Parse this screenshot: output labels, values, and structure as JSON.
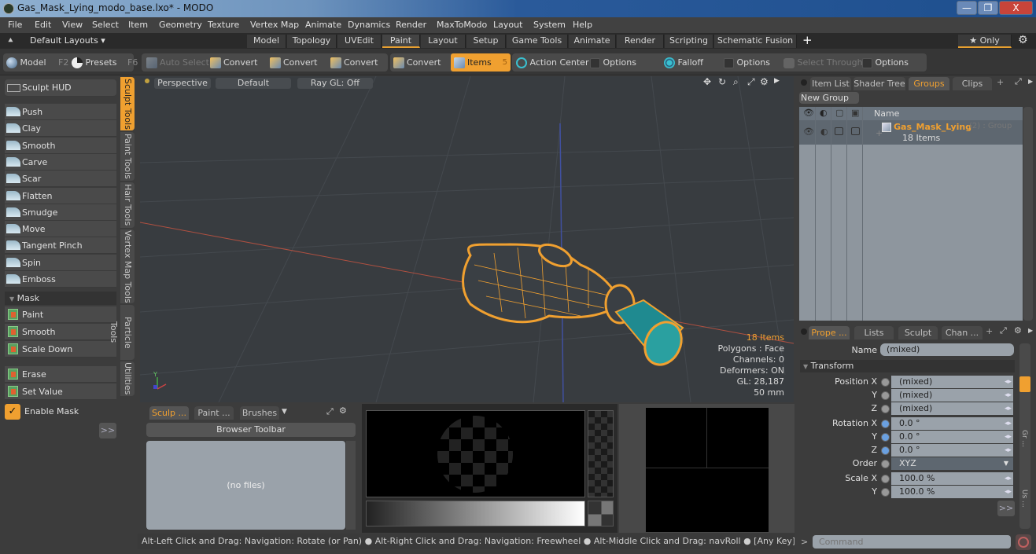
{
  "window": {
    "title": "Gas_Mask_Lying_modo_base.lxo* - MODO",
    "controls": {
      "minimize": "—",
      "maximize": "❐",
      "close": "X"
    }
  },
  "menu": [
    "File",
    "Edit",
    "View",
    "Select",
    "Item",
    "Geometry",
    "Texture",
    "Vertex Map",
    "Animate",
    "Dynamics",
    "Render",
    "MaxToModo",
    "Layout",
    "System",
    "Help"
  ],
  "layout_bar": {
    "layouts_label": "Default Layouts ▾",
    "tabs": [
      "Model",
      "Topology",
      "UVEdit",
      "Paint",
      "Layout",
      "Setup",
      "Game Tools",
      "Animate",
      "Render",
      "Scripting",
      "Schematic Fusion"
    ],
    "active_tab": "Paint",
    "add": "+",
    "only_label": "★ Only"
  },
  "toolbar": {
    "model": "Model",
    "model_key": "F2",
    "presets": "Presets",
    "presets_key": "F6",
    "auto_select": "Auto Select",
    "convert1": "Convert",
    "convert2": "Convert",
    "convert3": "Convert",
    "convert4": "Convert",
    "items": "Items",
    "items_count": "5",
    "action_center": "Action Center",
    "options1": "Options",
    "falloff": "Falloff",
    "options2": "Options",
    "select_through": "Select Through",
    "options3": "Options"
  },
  "left_panel": {
    "hud": "Sculpt HUD",
    "tools": [
      "Push",
      "Clay",
      "Smooth",
      "Carve",
      "Scar",
      "Flatten",
      "Smudge",
      "Move",
      "Tangent Pinch",
      "Spin",
      "Emboss"
    ],
    "mask_header": "Mask",
    "mask_tools": [
      "Paint",
      "Smooth",
      "Scale Down"
    ],
    "mask_tools2": [
      "Erase",
      "Set Value"
    ],
    "enable_mask": "Enable Mask",
    "enable_mask_checked": true,
    "more": ">>"
  },
  "vertical_tabs": [
    "Sculpt Tools",
    "Paint Tools",
    "Hair Tools",
    "Vertex Map Tools",
    "Particle Tools",
    "Utilities"
  ],
  "viewport": {
    "view": "Perspective",
    "shading": "Default",
    "raygl": "Ray GL: Off",
    "stats": {
      "items": "18 Items",
      "polygons": "Polygons : Face",
      "channels": "Channels: 0",
      "deformers": "Deformers: ON",
      "gl": "GL: 28,187",
      "scale": "50 mm"
    }
  },
  "bottom_left": {
    "tabs": [
      "Sculp ...",
      "Paint ...",
      "Brushes"
    ],
    "browser_toolbar": "Browser Toolbar",
    "empty": "(no files)"
  },
  "groups_panel": {
    "tabs": [
      "Item List",
      "Shader Tree",
      "Groups",
      "Clips"
    ],
    "active": "Groups",
    "new_group": "New Group",
    "col_name": "Name",
    "group_name": "Gas_Mask_Lying",
    "group_suffix": "(2) : Group",
    "group_items": "18 Items"
  },
  "properties": {
    "tabs": [
      "Prope ...",
      "Lists",
      "Sculpt",
      "Chan ..."
    ],
    "name_label": "Name",
    "name_value": "(mixed)",
    "transform": "Transform",
    "rows": [
      {
        "label": "Position X",
        "value": "(mixed)"
      },
      {
        "label": "Y",
        "value": "(mixed)"
      },
      {
        "label": "Z",
        "value": "(mixed)"
      },
      {
        "label": "Rotation X",
        "value": "0.0 °"
      },
      {
        "label": "Y",
        "value": "0.0 °"
      },
      {
        "label": "Z",
        "value": "0.0 °"
      },
      {
        "label": "Order",
        "value": "XYZ"
      },
      {
        "label": "Scale X",
        "value": "100.0 %"
      },
      {
        "label": "Y",
        "value": "100.0 %"
      }
    ],
    "more": ">>",
    "side_tabs": [
      "Gr ...",
      "Us ..."
    ]
  },
  "status": "Alt-Left Click and Drag: Navigation: Rotate (or Pan) ● Alt-Right Click and Drag: Navigation: Freewheel ● Alt-Middle Click and Drag: navRoll ● [Any Key]-[Any Button] Click an ...",
  "command": {
    "prompt": ">",
    "placeholder": "Command"
  },
  "colors": {
    "accent": "#f0a030",
    "panel": "#3c3c3c",
    "viewport": "#383c40",
    "wire": "#f0a030",
    "filter": "#2aa0a0"
  }
}
